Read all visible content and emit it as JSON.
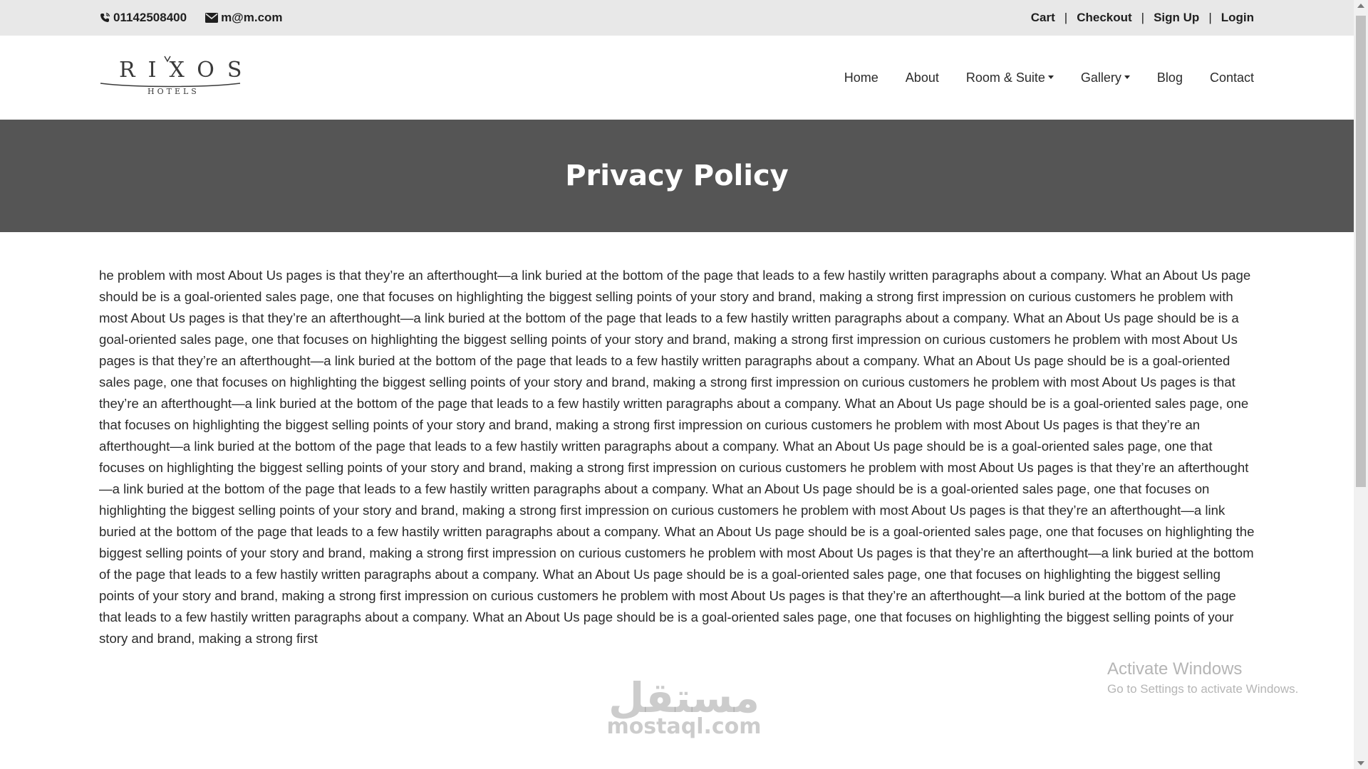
{
  "topbar": {
    "phone": "01142508400",
    "email": "m@m.com",
    "links": [
      "Cart",
      "Checkout",
      "Sign Up",
      "Login"
    ],
    "separator": "|",
    "background": "#e8e8e8"
  },
  "logo": {
    "word": "RIXOS",
    "sub": "HOTELS"
  },
  "nav": {
    "items": [
      {
        "label": "Home",
        "dropdown": false
      },
      {
        "label": "About",
        "dropdown": false
      },
      {
        "label": "Room & Suite",
        "dropdown": true
      },
      {
        "label": "Gallery",
        "dropdown": true
      },
      {
        "label": "Blog",
        "dropdown": false
      },
      {
        "label": "Contact",
        "dropdown": false
      }
    ]
  },
  "banner": {
    "title": "Privacy Policy",
    "background": "#555555"
  },
  "content": {
    "paragraph": "he problem with most About Us pages is that they’re an afterthought—a link buried at the bottom of the page that leads to a few hastily written paragraphs about a company. What an About Us page should be is a goal-oriented sales page, one that focuses on highlighting the biggest selling points of your story and brand, making a strong first impression on curious customers he problem with most About Us pages is that they’re an afterthought—a link buried at the bottom of the page that leads to a few hastily written paragraphs about a company. What an About Us page should be is a goal-oriented sales page, one that focuses on highlighting the biggest selling points of your story and brand, making a strong first impression on curious customers he problem with most About Us pages is that they’re an afterthought—a link buried at the bottom of the page that leads to a few hastily written paragraphs about a company. What an About Us page should be is a goal-oriented sales page, one that focuses on highlighting the biggest selling points of your story and brand, making a strong first impression on curious customers he problem with most About Us pages is that they’re an afterthought—a link buried at the bottom of the page that leads to a few hastily written paragraphs about a company. What an About Us page should be is a goal-oriented sales page, one that focuses on highlighting the biggest selling points of your story and brand, making a strong first impression on curious customers he problem with most About Us pages is that they’re an afterthought—a link buried at the bottom of the page that leads to a few hastily written paragraphs about a company. What an About Us page should be is a goal-oriented sales page, one that focuses on highlighting the biggest selling points of your story and brand, making a strong first impression on curious customers he problem with most About Us pages is that they’re an afterthought—a link buried at the bottom of the page that leads to a few hastily written paragraphs about a company. What an About Us page should be is a goal-oriented sales page, one that focuses on highlighting the biggest selling points of your story and brand, making a strong first impression on curious customers he problem with most About Us pages is that they’re an afterthought—a link buried at the bottom of the page that leads to a few hastily written paragraphs about a company. What an About Us page should be is a goal-oriented sales page, one that focuses on highlighting the biggest selling points of your story and brand, making a strong first impression on curious customers he problem with most About Us pages is that they’re an afterthought—a link buried at the bottom of the page that leads to a few hastily written paragraphs about a company. What an About Us page should be is a goal-oriented sales page, one that focuses on highlighting the biggest selling points of your story and brand, making a strong first impression on curious customers he problem with most About Us pages is that they’re an afterthought—a link buried at the bottom of the page that leads to a few hastily written paragraphs about a company. What an About Us page should be is a goal-oriented sales page, one that focuses on highlighting the biggest selling points of your story and brand, making a strong first"
  },
  "watermarks": {
    "windows_title": "Activate Windows",
    "windows_sub": "Go to Settings to activate Windows.",
    "site_ar": "مستقل",
    "site_lat": "mostaql.com"
  },
  "icons": {
    "phone": "phone-icon",
    "email": "envelope-icon",
    "caret": "caret-down-icon"
  }
}
